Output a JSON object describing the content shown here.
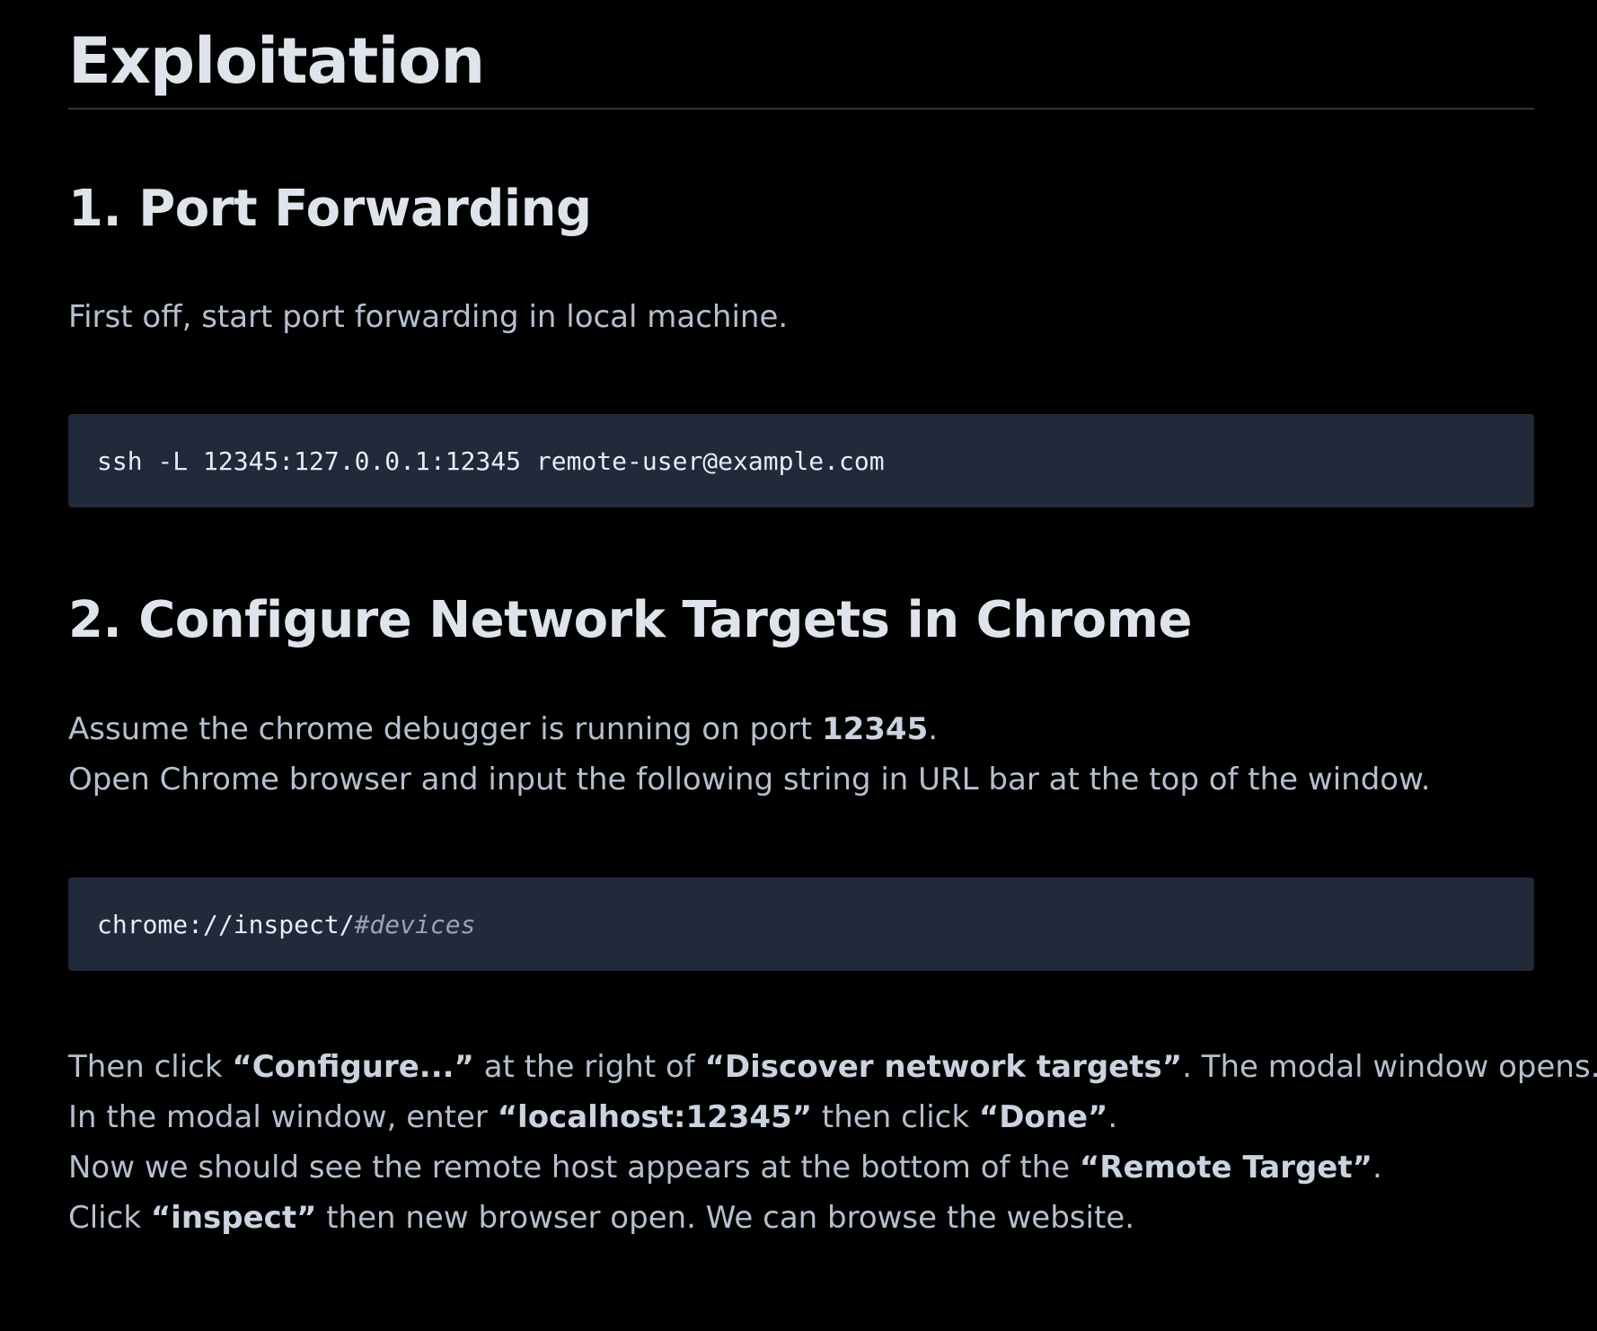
{
  "page": {
    "title": "Exploitation"
  },
  "section1": {
    "heading": "1. Port Forwarding",
    "intro": "First off, start port forwarding in local machine.",
    "code": "ssh -L 12345:127.0.0.1:12345 remote-user@example.com"
  },
  "section2": {
    "heading": "2. Configure Network Targets in Chrome",
    "p1": {
      "pre": "Assume the chrome debugger is running on port ",
      "bold": "12345",
      "post": "."
    },
    "p2": "Open Chrome browser and input the following string in URL bar at the top of the window.",
    "code": {
      "plain": "chrome://inspect/",
      "comment": "#devices"
    },
    "steps": {
      "l1": {
        "a": "Then click ",
        "b": "“Configure...”",
        "c": " at the right of ",
        "d": "“Discover network targets”",
        "e": ". The modal window opens."
      },
      "l2": {
        "a": "In the modal window, enter ",
        "b": "“localhost:12345”",
        "c": " then click ",
        "d": "“Done”",
        "e": "."
      },
      "l3": {
        "a": "Now we should see the remote host appears at the bottom of the ",
        "b": "“Remote Target”",
        "c": "."
      },
      "l4": {
        "a": "Click ",
        "b": "“inspect”",
        "c": " then new browser open. We can browse the website."
      }
    }
  },
  "colors": {
    "background": "#000000",
    "heading": "#dfe4ec",
    "body_text": "#b6bfce",
    "code_bg": "#212a3b",
    "code_text": "#e8ecf2",
    "code_comment": "#9aa3b1",
    "rule": "#2c3442"
  }
}
